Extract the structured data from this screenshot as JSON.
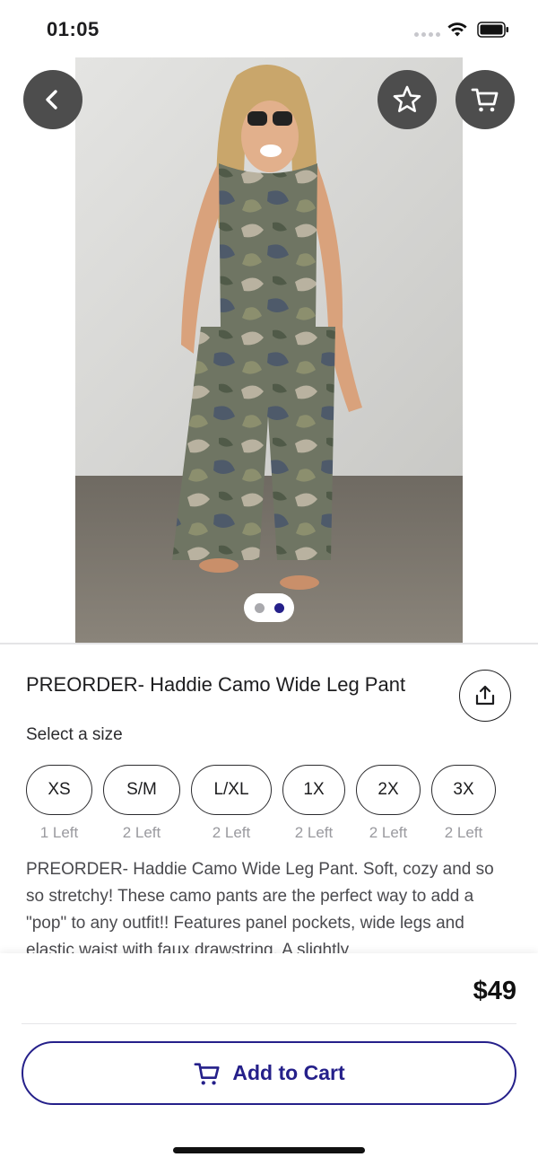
{
  "status_bar": {
    "time": "01:05"
  },
  "product": {
    "title": "PREORDER- Haddie Camo Wide Leg Pant",
    "size_prompt": "Select a size",
    "sizes": [
      {
        "label": "XS",
        "stock": "1 Left"
      },
      {
        "label": "S/M",
        "stock": "2 Left"
      },
      {
        "label": "L/XL",
        "stock": "2 Left"
      },
      {
        "label": "1X",
        "stock": "2 Left"
      },
      {
        "label": "2X",
        "stock": "2 Left"
      },
      {
        "label": "3X",
        "stock": "2 Left"
      }
    ],
    "description": "PREORDER- Haddie Camo Wide Leg Pant. Soft, cozy and so so stretchy! These  camo pants are the perfect way to add a \"pop\" to any outfit!! Features panel pockets, wide legs and elastic waist with faux drawstring. A slightly",
    "price": "$49",
    "image_pages": 2,
    "current_image_page": 2
  },
  "actions": {
    "add_to_cart_label": "Add to Cart"
  },
  "icons": {
    "back": "chevron-left-icon",
    "favorite": "star-icon",
    "cart": "cart-icon",
    "share": "share-icon"
  },
  "colors": {
    "accent": "#25208a",
    "overlay_button": "#4d4d4d"
  }
}
